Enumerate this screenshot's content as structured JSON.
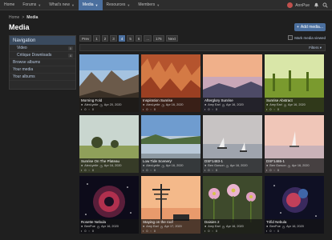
{
  "nav": {
    "tabs": [
      {
        "label": "Home"
      },
      {
        "label": "Forums"
      },
      {
        "label": "What's new"
      },
      {
        "label": "Media"
      },
      {
        "label": "Resources"
      },
      {
        "label": "Members"
      }
    ],
    "user": "AnnPue"
  },
  "breadcrumb": {
    "home": "Home",
    "sep": ">",
    "current": "Media"
  },
  "page": {
    "title": "Media",
    "add_button": "Add media..."
  },
  "sidebar": {
    "heading": "Navigation",
    "items": [
      {
        "label": "Video",
        "count": "0"
      },
      {
        "label": "Critique Downloads",
        "count": "4"
      },
      {
        "label": "Browse albums"
      },
      {
        "label": "Your media"
      },
      {
        "label": "Your albums"
      }
    ]
  },
  "pager": {
    "prev": "Prev",
    "pages": [
      "1",
      "2",
      "3",
      "4",
      "5",
      "6",
      "...",
      "176"
    ],
    "active": "4",
    "next": "Next"
  },
  "mark_viewed": "Mark media viewed",
  "filters": "Filters",
  "media": [
    {
      "title": "Morning Fold",
      "user": "AlexLyelie",
      "date": "Apr 20, 2020",
      "comments": "0",
      "reactions": "0"
    },
    {
      "title": "Inspiration Sunrise",
      "user": "AlexLyelie",
      "date": "Apr 16, 2020",
      "comments": "0",
      "reactions": "0"
    },
    {
      "title": "Afterglory Sunrise",
      "user": "Amy Earl",
      "date": "Apr 16, 2020",
      "comments": "0",
      "reactions": "0"
    },
    {
      "title": "Sunrise Abstract",
      "user": "Amy Earl",
      "date": "Apr 16, 2020",
      "comments": "0",
      "reactions": "0"
    },
    {
      "title": "Sunrise On The Plateau",
      "user": "AlexLyelie",
      "date": "Apr 16, 2020",
      "comments": "0",
      "reactions": "0"
    },
    {
      "title": "Low Tide Scenery",
      "user": "AlexLyelie",
      "date": "Apr 16, 2020",
      "comments": "0",
      "reactions": "0"
    },
    {
      "title": "DSF1483-1",
      "user": "Ben Gorson",
      "date": "Apr 16, 2020",
      "comments": "0",
      "reactions": "0"
    },
    {
      "title": "DSF1465-1",
      "user": "Ben Gorson",
      "date": "Apr 16, 2020",
      "comments": "0",
      "reactions": "0"
    },
    {
      "title": "Rosette Nebula",
      "user": "BenPue",
      "date": "Apr 16, 2020",
      "comments": "0",
      "reactions": "0"
    },
    {
      "title": "Staying on the roof",
      "user": "Amy Earl",
      "date": "Apr 17, 2020",
      "comments": "0",
      "reactions": "0"
    },
    {
      "title": "Daisies 2",
      "user": "Amy Earl",
      "date": "Apr 16, 2020",
      "comments": "0",
      "reactions": "0"
    },
    {
      "title": "Trifid Nebula",
      "user": "BenPue",
      "date": "Apr 16, 2020",
      "comments": "0",
      "reactions": "0"
    }
  ]
}
